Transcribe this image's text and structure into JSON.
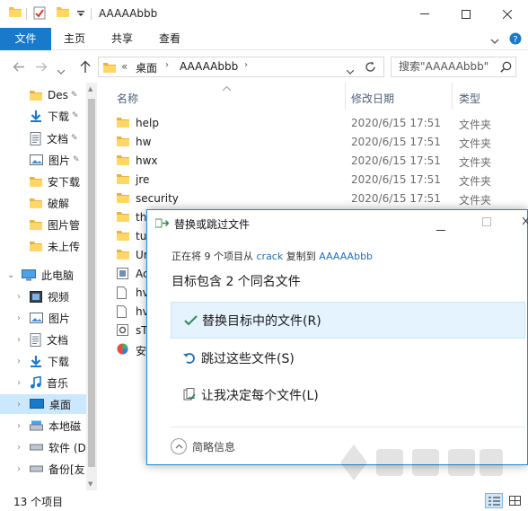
{
  "window": {
    "title": "AAAAAbbb",
    "colors": {
      "accent": "#1979ca",
      "folder": "#f0c14b",
      "dialog_border": "#1f8ad8"
    }
  },
  "ribbon": {
    "tabs": [
      "文件",
      "主页",
      "共享",
      "查看"
    ]
  },
  "address": {
    "prefix": "«",
    "segments": [
      "桌面",
      "AAAAAbbb"
    ]
  },
  "search": {
    "placeholder": "搜索\"AAAAAbbb\""
  },
  "nav": {
    "items": [
      {
        "label": "Des",
        "icon": "folder-icon",
        "pinned": true
      },
      {
        "label": "下载",
        "icon": "download-icon",
        "pinned": true
      },
      {
        "label": "文档",
        "icon": "document-icon",
        "pinned": true
      },
      {
        "label": "图片",
        "icon": "picture-icon",
        "pinned": true
      },
      {
        "label": "安下载",
        "icon": "folder-icon"
      },
      {
        "label": "破解",
        "icon": "folder-icon"
      },
      {
        "label": "图片管",
        "icon": "folder-icon"
      },
      {
        "label": "未上传",
        "icon": "folder-icon"
      },
      {
        "label": "此电脑",
        "icon": "computer-icon"
      },
      {
        "label": "视频",
        "icon": "video-icon"
      },
      {
        "label": "图片",
        "icon": "picture-icon"
      },
      {
        "label": "文档",
        "icon": "document-icon"
      },
      {
        "label": "下载",
        "icon": "download-icon"
      },
      {
        "label": "音乐",
        "icon": "music-icon"
      },
      {
        "label": "桌面",
        "icon": "desktop-icon",
        "selected": true
      },
      {
        "label": "本地磁",
        "icon": "drive-icon"
      },
      {
        "label": "软件 (D",
        "icon": "drive-icon"
      },
      {
        "label": "备份[友",
        "icon": "drive-icon"
      }
    ]
  },
  "list": {
    "columns": {
      "name": "名称",
      "date": "修改日期",
      "type": "类型"
    },
    "rows": [
      {
        "name": "help",
        "date": "2020/6/15 17:51",
        "type": "文件夹",
        "icon": "folder-icon"
      },
      {
        "name": "hw",
        "date": "2020/6/15 17:51",
        "type": "文件夹",
        "icon": "folder-icon"
      },
      {
        "name": "hwx",
        "date": "2020/6/15 17:51",
        "type": "文件夹",
        "icon": "folder-icon"
      },
      {
        "name": "jre",
        "date": "2020/6/15 17:51",
        "type": "文件夹",
        "icon": "folder-icon"
      },
      {
        "name": "security",
        "date": "2020/6/15 17:51",
        "type": "文件夹",
        "icon": "folder-icon"
      },
      {
        "name": "th",
        "date": "",
        "type": "",
        "icon": "folder-icon"
      },
      {
        "name": "tu",
        "date": "",
        "type": "",
        "icon": "folder-icon"
      },
      {
        "name": "Ur",
        "date": "",
        "type": "",
        "icon": "folder-icon"
      },
      {
        "name": "Ac",
        "date": "",
        "type": "",
        "icon": "app-icon"
      },
      {
        "name": "hv",
        "date": "",
        "type": "",
        "icon": "file-icon"
      },
      {
        "name": "hv",
        "date": "",
        "type": "",
        "icon": "file-icon"
      },
      {
        "name": "sT",
        "date": "",
        "type": "",
        "icon": "settings-file-icon"
      },
      {
        "name": "安",
        "date": "",
        "type": "",
        "icon": "colorful-app-icon"
      }
    ]
  },
  "status": {
    "count": "13 个项目"
  },
  "dialog": {
    "title": "替换或跳过文件",
    "progress_prefix": "正在将",
    "progress_count": "9",
    "progress_mid": "个项目从",
    "source": "crack",
    "progress_copy": "复制到",
    "dest": "AAAAAbbb",
    "conflict": "目标包含 2 个同名文件",
    "options": [
      {
        "label": "替换目标中的文件(R)",
        "icon": "checkmark-icon"
      },
      {
        "label": "跳过这些文件(S)",
        "icon": "skip-icon"
      },
      {
        "label": "让我决定每个文件(L)",
        "icon": "decide-icon"
      }
    ],
    "brief_label": "简略信息"
  }
}
